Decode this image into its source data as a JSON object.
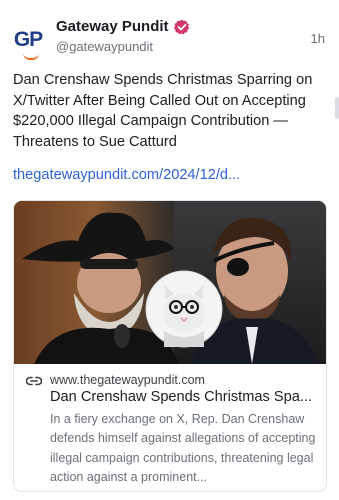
{
  "author": {
    "avatar_text": "GP",
    "display_name": "Gateway Pundit",
    "handle": "@gatewaypundit",
    "verified_icon": "verified-badge-icon",
    "verified_color": "#d2396a"
  },
  "timestamp": "1h",
  "post": {
    "text": "Dan Crenshaw Spends Christmas Sparring on X/Twitter After Being Called Out on Accepting $220,000 Illegal Campaign Contribution — Threatens to Sue Catturd",
    "link": "thegatewaypundit.com/2024/12/d..."
  },
  "card": {
    "domain": "www.thegatewaypundit.com",
    "title": "Dan Crenshaw Spends Christmas Spa...",
    "description": "In a fiery exchange on X, Rep. Dan Crenshaw defends himself against allegations of accepting illegal campaign contributions, threatening legal action against a prominent...",
    "link_icon": "link-icon"
  },
  "colors": {
    "link": "#2e62d7",
    "brand_blue": "#1f3e85",
    "brand_orange": "#e8691f"
  }
}
